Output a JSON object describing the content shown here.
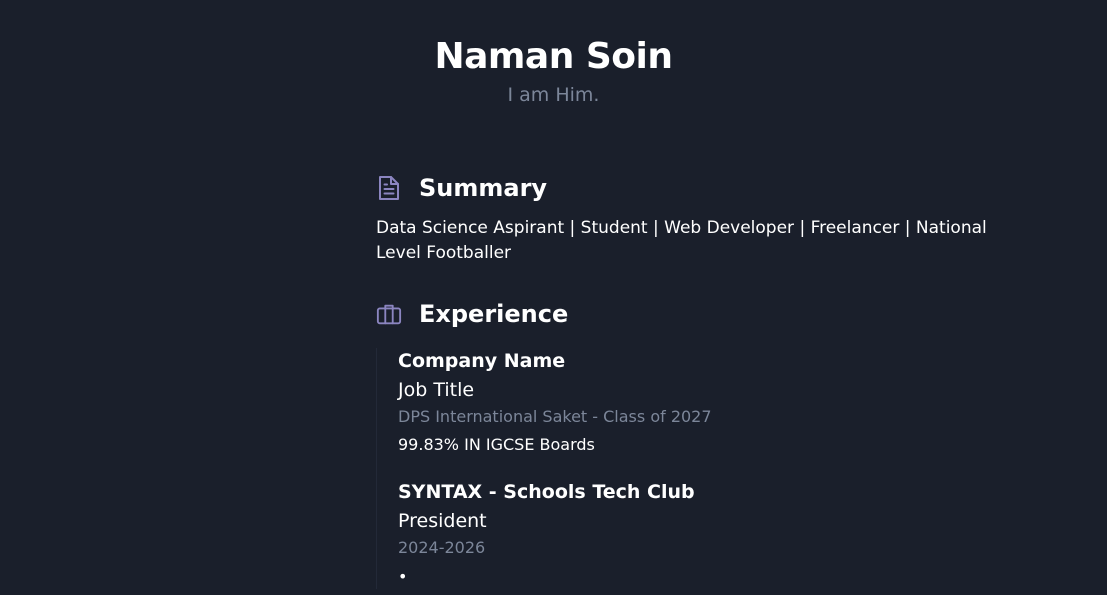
{
  "header": {
    "name": "Naman Soin",
    "tagline": "I am Him."
  },
  "summary": {
    "title": "Summary",
    "icon": "document-icon",
    "text": "Data Science Aspirant | Student | Web Developer | Freelancer | National Level Footballer"
  },
  "experience": {
    "title": "Experience",
    "icon": "briefcase-icon",
    "items": [
      {
        "company": "Company Name",
        "job_title": "Job Title",
        "meta": "DPS International Saket - Class of 2027",
        "description": "99.83% IN IGCSE Boards"
      },
      {
        "company": "SYNTAX - Schools Tech Club",
        "job_title": "President",
        "meta": "2024-2026",
        "bullet": "•"
      }
    ]
  },
  "colors": {
    "background": "#1a1f2b",
    "muted": "#7c8699",
    "icon": "#8b85c0"
  }
}
